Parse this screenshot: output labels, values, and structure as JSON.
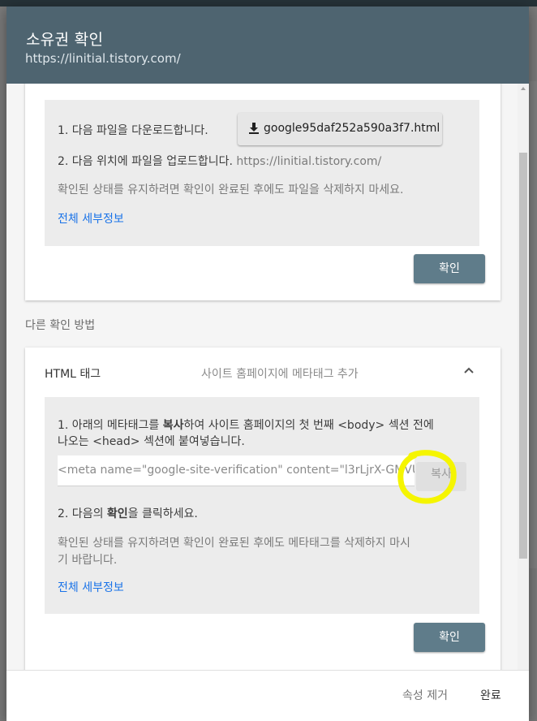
{
  "dialog": {
    "title": "소유권 확인",
    "subtitle": "https://linitial.tistory.com/"
  },
  "file_method": {
    "step1": "1. 다음 파일을 다운로드합니다.",
    "download_file": "google95daf252a590a3f7.html",
    "step2_prefix": "2. 다음 위치에 파일을 업로드합니다.",
    "step2_url": "https://linitial.tistory.com/",
    "note": "확인된 상태를 유지하려면 확인이 완료된 후에도 파일을 삭제하지 마세요.",
    "details_link": "전체 세부정보",
    "verify_button": "확인"
  },
  "other_methods_label": "다른 확인 방법",
  "html_tag_method": {
    "name": "HTML 태그",
    "description": "사이트 홈페이지에 메타태그 추가",
    "step1_line1_a": "1. 아래의 메타태그를 ",
    "step1_line1_bold": "복사",
    "step1_line1_b": "하여 사이트 홈페이지의 첫 번째 <body> 섹션 전에",
    "step1_line2": "나오는 <head> 섹션에 붙여넣습니다.",
    "meta_value": "<meta name=\"google-site-verification\" content=\"l3rLjrX-GMVU\"",
    "copy_button": "복사",
    "step2_a": "2. 다음의 ",
    "step2_bold": "확인",
    "step2_b": "을 클릭하세요.",
    "note_line1": "확인된 상태를 유지하려면 확인이 완료된 후에도 메타태그를 삭제하지 마시",
    "note_line2": "기 바랍니다.",
    "details_link": "전체 세부정보",
    "verify_button": "확인"
  },
  "footer": {
    "remove_property": "속성 제거",
    "done": "완료"
  },
  "colors": {
    "header": "#4e6470",
    "primary_button": "#5f7c8a",
    "link": "#1a73e8",
    "highlight": "#f5f500"
  }
}
